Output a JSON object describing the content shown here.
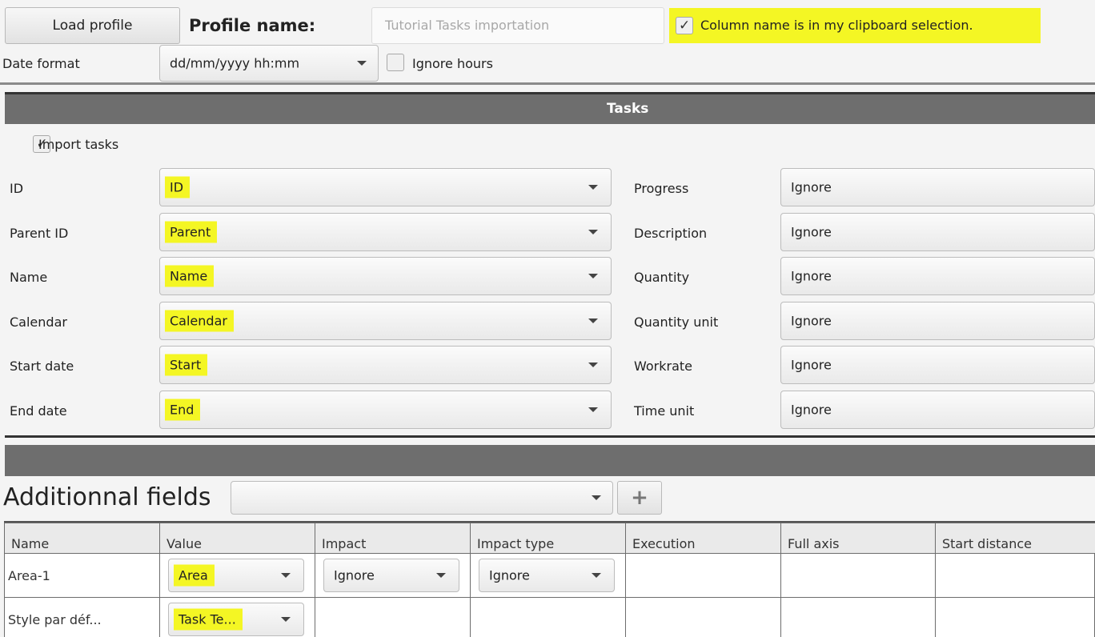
{
  "profile": {
    "load_button": "Load profile",
    "name_label": "Profile name:",
    "name_placeholder": "Tutorial Tasks importation",
    "clipboard_checkbox": "Column name is in my clipboard selection.",
    "date_format_label": "Date format",
    "date_format_value": "dd/mm/yyyy hh:mm",
    "ignore_hours_label": "Ignore hours"
  },
  "tasks": {
    "section_title": "Tasks",
    "import_tasks_label": "Import tasks",
    "left_fields": [
      {
        "label": "ID",
        "value": "ID"
      },
      {
        "label": "Parent ID",
        "value": "Parent"
      },
      {
        "label": "Name",
        "value": "Name"
      },
      {
        "label": "Calendar",
        "value": "Calendar"
      },
      {
        "label": "Start date",
        "value": "Start"
      },
      {
        "label": "End date",
        "value": "End"
      }
    ],
    "right_fields": [
      {
        "label": "Progress",
        "value": "Ignore"
      },
      {
        "label": "Description",
        "value": "Ignore"
      },
      {
        "label": "Quantity",
        "value": "Ignore"
      },
      {
        "label": "Quantity unit",
        "value": "Ignore"
      },
      {
        "label": "Workrate",
        "value": "Ignore"
      },
      {
        "label": "Time unit",
        "value": "Ignore"
      }
    ]
  },
  "additional": {
    "title": "Additionnal fields",
    "add_button": "+",
    "columns": [
      "Name",
      "Value",
      "Impact",
      "Impact type",
      "Execution",
      "Full axis",
      "Start distance"
    ],
    "rows": [
      {
        "name": "Area-1",
        "value": "Area",
        "impact": "Ignore",
        "impact_type": "Ignore"
      },
      {
        "name": "Style par déf...",
        "value": "Task Te..."
      }
    ]
  },
  "colors": {
    "highlight": "#f4f624",
    "section_bar": "#6e6e6e"
  }
}
